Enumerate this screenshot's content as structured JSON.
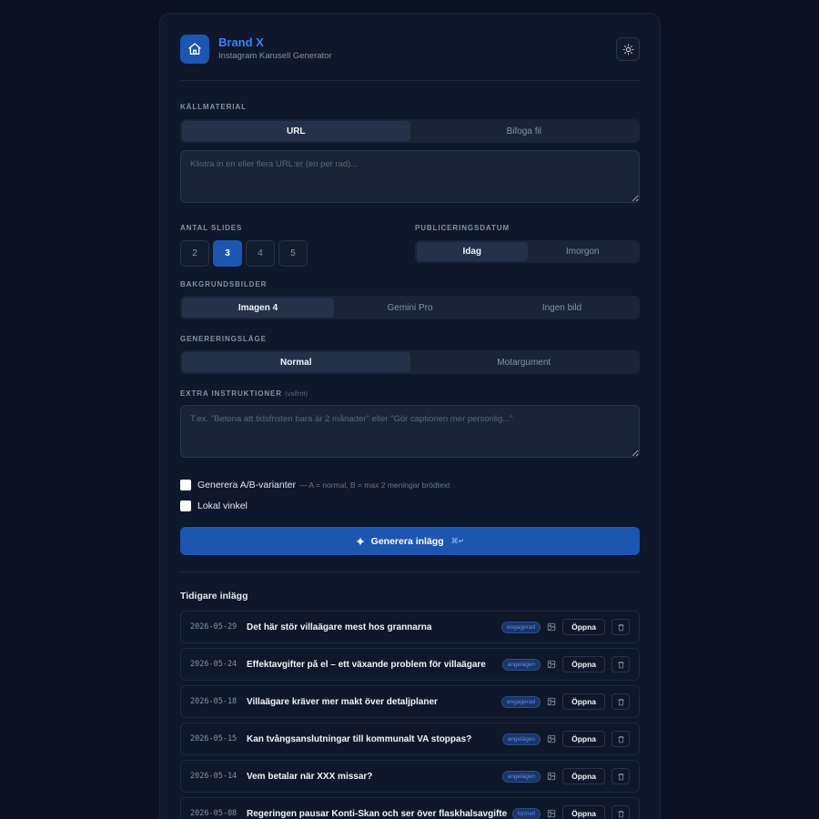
{
  "header": {
    "brand_name": "Brand X",
    "brand_sub": "Instagram Karusell Generator",
    "logo_icon": "home-icon",
    "theme_icon": "sun-icon"
  },
  "source": {
    "label": "KÄLLMATERIAL",
    "tabs": [
      {
        "label": "URL",
        "active": true
      },
      {
        "label": "Bifoga fil",
        "active": false
      }
    ],
    "placeholder": "Klistra in en eller flera URL:er (en per rad)..."
  },
  "slides": {
    "label": "ANTAL SLIDES",
    "options": [
      "2",
      "3",
      "4",
      "5"
    ],
    "selected": "3"
  },
  "publish": {
    "label": "PUBLICERINGSDATUM",
    "options": [
      {
        "label": "Idag",
        "active": true
      },
      {
        "label": "Imorgon",
        "active": false
      }
    ]
  },
  "background": {
    "label": "BAKGRUNDSBILDER",
    "options": [
      {
        "label": "Imagen 4",
        "active": true
      },
      {
        "label": "Gemini Pro",
        "active": false
      },
      {
        "label": "Ingen bild",
        "active": false
      }
    ]
  },
  "mode": {
    "label": "GENERERINGSLÄGE",
    "options": [
      {
        "label": "Normal",
        "active": true
      },
      {
        "label": "Motargument",
        "active": false
      }
    ]
  },
  "extra": {
    "label": "EXTRA INSTRUKTIONER",
    "optional": "(valfritt)",
    "placeholder": "T.ex. \"Betona att tidsfristen bara är 2 månader\" eller \"Gör captionen mer personlig...\""
  },
  "options": {
    "ab_label": "Generera A/B-varianter",
    "ab_hint": "— A = normal, B = max 2 meningar brödtext",
    "local_label": "Lokal vinkel"
  },
  "generate": {
    "label": "Generera inlägg",
    "shortcut": "⌘↵"
  },
  "history": {
    "title": "Tidigare inlägg",
    "open_label": "Öppna",
    "rows": [
      {
        "date": "2026-05-29",
        "title": "Det här stör villaägare mest hos grannarna",
        "badge": "engagerad"
      },
      {
        "date": "2026-05-24",
        "title": "Effektavgifter på el – ett växande problem för villaägare",
        "badge": "angelägen"
      },
      {
        "date": "2026-05-18",
        "title": "Villaägare kräver mer makt över detaljplaner",
        "badge": "engagerad"
      },
      {
        "date": "2026-05-15",
        "title": "Kan tvångsanslutningar till kommunalt VA stoppas?",
        "badge": "angelägen"
      },
      {
        "date": "2026-05-14",
        "title": "Vem betalar när XXX missar?",
        "badge": "angelägen"
      },
      {
        "date": "2026-05-08",
        "title": "Regeringen pausar Konti-Skan och ser över flaskhalsavgifter",
        "badge": "formell"
      }
    ]
  },
  "colors": {
    "accent": "#1d56b0",
    "brand_text": "#3b82f6",
    "background": "#0b1120",
    "card": "#0f172a"
  }
}
